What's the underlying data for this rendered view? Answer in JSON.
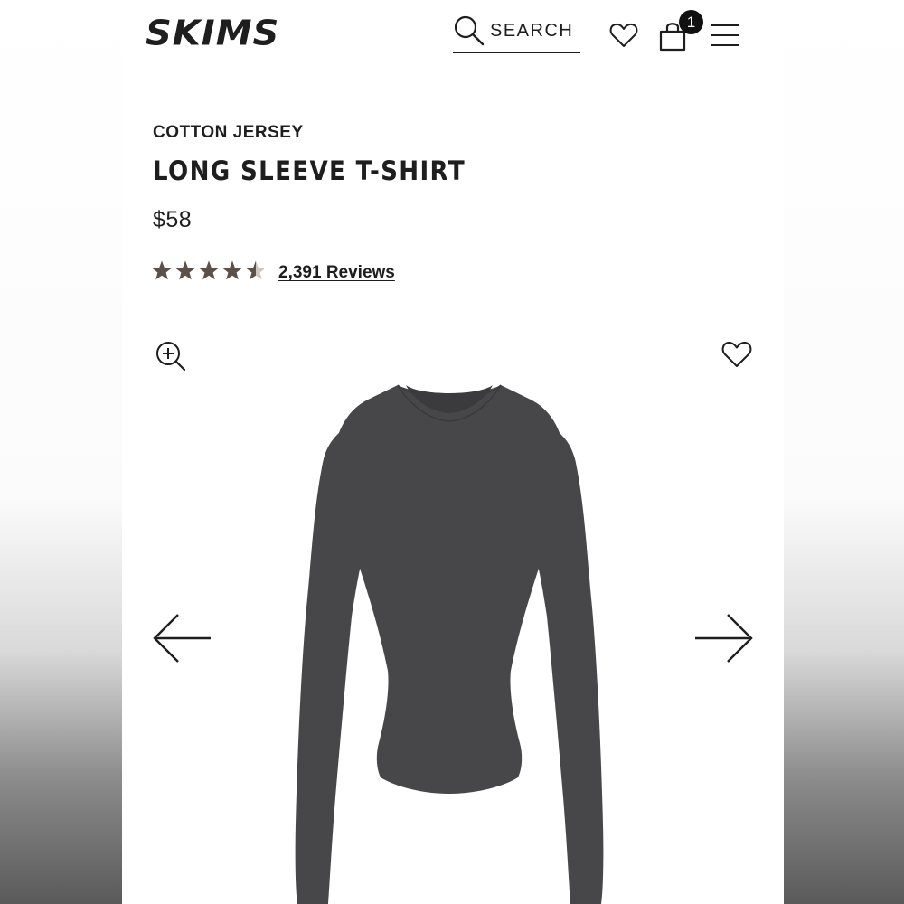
{
  "brand": {
    "logo_text": "SKIMS"
  },
  "header": {
    "search_label": "SEARCH",
    "cart_count": "1",
    "icons": [
      "search-icon",
      "heart-icon",
      "shopping-bag-icon",
      "hamburger-menu-icon"
    ]
  },
  "product": {
    "collection": "COTTON JERSEY",
    "title": "LONG SLEEVE T-SHIRT",
    "price": "$58",
    "rating": 4.5,
    "rating_max": 5,
    "reviews_label": "2,391 Reviews",
    "garment_color": "#47474a"
  },
  "gallery": {
    "icons": [
      "zoom-in-icon",
      "heart-icon",
      "arrow-left-icon",
      "arrow-right-icon"
    ]
  },
  "colors": {
    "text": "#1e1e1e",
    "star": "#5b5148",
    "badge": "#111111"
  }
}
